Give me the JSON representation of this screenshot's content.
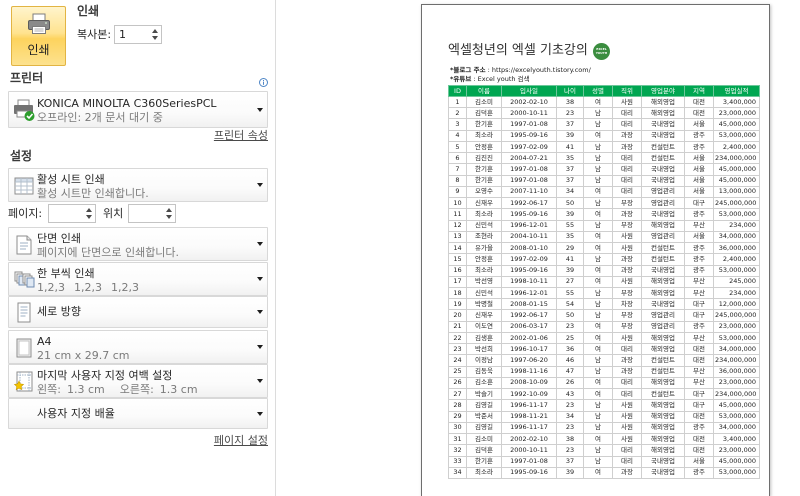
{
  "print_button": {
    "label": "인쇄",
    "icon": "printer-icon"
  },
  "print_section": {
    "title": "인쇄",
    "copies_label": "복사본:",
    "copies_value": "1"
  },
  "printer_section": {
    "title": "프린터",
    "info_icon": "info-icon",
    "printer_icon": "printer-ready-icon",
    "printer_name": "KONICA MINOLTA C360SeriesPCL",
    "printer_status": "오프라인: 2개 문서 대기 중",
    "properties_link": "프린터 속성"
  },
  "settings": {
    "title": "설정",
    "print_what": {
      "title": "활성 시트 인쇄",
      "desc": "활성 시트만 인쇄합니다.",
      "icon": "sheet-icon"
    },
    "pages": {
      "label": "페이지:",
      "from_value": "",
      "to_label": "위치",
      "to_value": ""
    },
    "sides": {
      "title": "단면 인쇄",
      "desc": "페이지에 단면으로 인쇄합니다.",
      "icon": "one-sided-icon"
    },
    "collation": {
      "title": "한 부씩 인쇄",
      "desc": [
        "1,2,3",
        "1,2,3",
        "1,2,3"
      ],
      "icon": "collated-icon"
    },
    "orientation": {
      "title": "세로 방향",
      "icon": "portrait-icon"
    },
    "paper": {
      "title": "A4",
      "desc": "21 cm x 29.7 cm",
      "icon": "paper-size-icon"
    },
    "margins": {
      "title": "마지막 사용자 지정 여백 설정",
      "left_label": "왼쪽:",
      "left_value": "1.3 cm",
      "right_label": "오른쪽:",
      "right_value": "1.3 cm",
      "icon": "custom-margins-icon"
    },
    "scaling": {
      "title": "사용자 지정 배율"
    },
    "page_setup_link": "페이지 설정"
  },
  "preview": {
    "sheet_title": "엑셀청년의 엑셀 기초강의",
    "logo_text": [
      "EXCEL",
      "YOUTH"
    ],
    "blog_label": "*블로그 주소",
    "blog_value": ": https://excelyouth.tistory.com/",
    "youtube_label": "*유튜브",
    "youtube_value": ": Excel youth 검색",
    "table": {
      "headers": [
        "ID",
        "이름",
        "입사일",
        "나이",
        "성별",
        "직위",
        "영업분야",
        "지역",
        "영업실적"
      ],
      "rows": [
        [
          "1",
          "김소미",
          "2002-02-10",
          "38",
          "여",
          "사원",
          "해외영업",
          "대전",
          "3,400,000"
        ],
        [
          "2",
          "김덕훈",
          "2000-10-11",
          "23",
          "남",
          "대리",
          "해외영업",
          "대전",
          "23,000,000"
        ],
        [
          "3",
          "한기훈",
          "1997-01-08",
          "37",
          "남",
          "대리",
          "국내영업",
          "서울",
          "45,000,000"
        ],
        [
          "4",
          "최소라",
          "1995-09-16",
          "39",
          "여",
          "과장",
          "국내영업",
          "광주",
          "53,000,000"
        ],
        [
          "5",
          "안정훈",
          "1997-02-09",
          "41",
          "남",
          "과장",
          "컨설턴트",
          "광주",
          "2,400,000"
        ],
        [
          "6",
          "김진진",
          "2004-07-21",
          "35",
          "남",
          "대리",
          "컨설턴트",
          "서울",
          "234,000,000"
        ],
        [
          "7",
          "한기훈",
          "1997-01-08",
          "37",
          "남",
          "대리",
          "국내영업",
          "서울",
          "45,000,000"
        ],
        [
          "8",
          "한기훈",
          "1997-01-08",
          "37",
          "남",
          "대리",
          "국내영업",
          "서울",
          "45,000,000"
        ],
        [
          "9",
          "오영수",
          "2007-11-10",
          "34",
          "여",
          "대리",
          "영업관리",
          "서울",
          "13,000,000"
        ],
        [
          "10",
          "신재우",
          "1992-06-17",
          "50",
          "남",
          "부장",
          "영업관리",
          "대구",
          "245,000,000"
        ],
        [
          "11",
          "최소라",
          "1995-09-16",
          "39",
          "여",
          "과장",
          "국내영업",
          "광주",
          "53,000,000"
        ],
        [
          "12",
          "신민석",
          "1996-12-01",
          "55",
          "남",
          "부장",
          "해외영업",
          "부산",
          "234,000"
        ],
        [
          "13",
          "조현라",
          "2004-10-11",
          "35",
          "여",
          "사원",
          "영업관리",
          "서울",
          "34,000,000"
        ],
        [
          "14",
          "유가을",
          "2008-01-10",
          "29",
          "여",
          "사원",
          "컨설턴트",
          "광주",
          "36,000,000"
        ],
        [
          "15",
          "안정훈",
          "1997-02-09",
          "41",
          "남",
          "과장",
          "컨설턴트",
          "광주",
          "2,400,000"
        ],
        [
          "16",
          "최소라",
          "1995-09-16",
          "39",
          "여",
          "과장",
          "국내영업",
          "광주",
          "53,000,000"
        ],
        [
          "17",
          "박선영",
          "1998-10-11",
          "27",
          "여",
          "사원",
          "해외영업",
          "부산",
          "245,000"
        ],
        [
          "18",
          "신민석",
          "1996-12-01",
          "55",
          "남",
          "부장",
          "해외영업",
          "부산",
          "234,000"
        ],
        [
          "19",
          "박명철",
          "2008-01-15",
          "54",
          "남",
          "차장",
          "국내영업",
          "대구",
          "12,000,000"
        ],
        [
          "20",
          "신재우",
          "1992-06-17",
          "50",
          "남",
          "부장",
          "영업관리",
          "대구",
          "245,000,000"
        ],
        [
          "21",
          "이도연",
          "2006-03-17",
          "23",
          "여",
          "부장",
          "영업관리",
          "광주",
          "23,000,000"
        ],
        [
          "22",
          "김생훈",
          "2002-01-06",
          "25",
          "여",
          "사원",
          "해외영업",
          "부산",
          "53,000,000"
        ],
        [
          "23",
          "박선희",
          "1996-10-17",
          "36",
          "여",
          "대리",
          "해외영업",
          "대전",
          "34,000,000"
        ],
        [
          "24",
          "이정남",
          "1997-06-20",
          "46",
          "남",
          "과장",
          "컨설턴트",
          "대전",
          "234,000,000"
        ],
        [
          "25",
          "김동욱",
          "1998-11-16",
          "47",
          "남",
          "과장",
          "컨설턴트",
          "부산",
          "36,000,000"
        ],
        [
          "26",
          "김소훈",
          "2008-10-09",
          "26",
          "여",
          "대리",
          "해외영업",
          "부산",
          "23,000,000"
        ],
        [
          "27",
          "박슬기",
          "1992-10-09",
          "43",
          "여",
          "대리",
          "컨설턴트",
          "대구",
          "234,000,000"
        ],
        [
          "28",
          "김영길",
          "1996-11-17",
          "23",
          "남",
          "사원",
          "해외영업",
          "대구",
          "45,000,000"
        ],
        [
          "29",
          "박준서",
          "1998-11-21",
          "34",
          "남",
          "사원",
          "해외영업",
          "대전",
          "53,000,000"
        ],
        [
          "30",
          "김영길",
          "1996-11-17",
          "23",
          "남",
          "사원",
          "해외영업",
          "광주",
          "34,000,000"
        ],
        [
          "31",
          "김소미",
          "2002-02-10",
          "38",
          "여",
          "사원",
          "해외영업",
          "대전",
          "3,400,000"
        ],
        [
          "32",
          "김덕훈",
          "2000-10-11",
          "23",
          "남",
          "대리",
          "해외영업",
          "대전",
          "23,000,000"
        ],
        [
          "33",
          "한기훈",
          "1997-01-08",
          "37",
          "남",
          "대리",
          "국내영업",
          "서울",
          "45,000,000"
        ],
        [
          "34",
          "최소라",
          "1995-09-16",
          "39",
          "여",
          "과장",
          "국내영업",
          "광주",
          "53,000,000"
        ]
      ]
    }
  },
  "colors": {
    "print_button": "#fdd66b",
    "table_header": "#00a651",
    "logo": "#3b8d3f",
    "status_check": "#2d9e2d",
    "info_icon": "#4f86c6",
    "margin_star": "#f5c400"
  }
}
